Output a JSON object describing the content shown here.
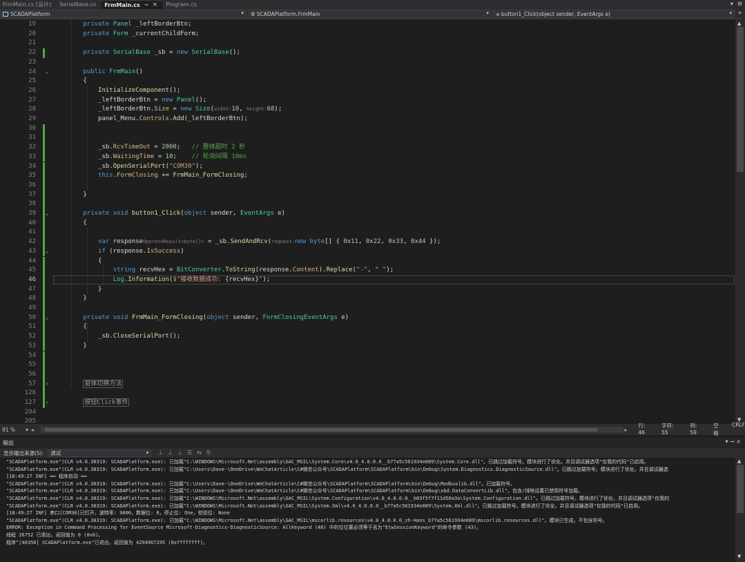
{
  "tabs": [
    {
      "label": "FrmMain.cs [设计]",
      "active": false
    },
    {
      "label": "SerialBase.cs",
      "active": false
    },
    {
      "label": "FrmMain.cs",
      "active": true
    },
    {
      "label": "Program.cs",
      "active": false
    }
  ],
  "nav": {
    "project": "SCADAPlatform",
    "class": "SCADAPlatform.FrmMain",
    "member": "button1_Click(object sender, EventArgs e)"
  },
  "code_lines": [
    {
      "n": "19",
      "tokens": [
        [
          "        ",
          ""
        ],
        [
          "private",
          "kw"
        ],
        [
          " ",
          ""
        ],
        [
          "Panel",
          "ty"
        ],
        [
          " _leftBorderBtn;",
          "id"
        ]
      ]
    },
    {
      "n": "20",
      "tokens": [
        [
          "        ",
          ""
        ],
        [
          "private",
          "kw"
        ],
        [
          " ",
          ""
        ],
        [
          "Form",
          "ty"
        ],
        [
          " _currentChildForm;",
          "id"
        ]
      ]
    },
    {
      "n": "21",
      "tokens": []
    },
    {
      "n": "22",
      "tokens": [
        [
          "        ",
          ""
        ],
        [
          "private",
          "kw"
        ],
        [
          " ",
          ""
        ],
        [
          "SerialBase",
          "ty"
        ],
        [
          " _sb = ",
          "id"
        ],
        [
          "new",
          "kw"
        ],
        [
          " ",
          ""
        ],
        [
          "SerialBase",
          "ty"
        ],
        [
          "();",
          "id"
        ]
      ]
    },
    {
      "n": "23",
      "tokens": []
    },
    {
      "n": "24",
      "tokens": [
        [
          "        ",
          ""
        ],
        [
          "public",
          "kw"
        ],
        [
          " ",
          ""
        ],
        [
          "FrmMain",
          "ty"
        ],
        [
          "()",
          "id"
        ]
      ]
    },
    {
      "n": "25",
      "tokens": [
        [
          "        {",
          "id"
        ]
      ]
    },
    {
      "n": "26",
      "tokens": [
        [
          "            ",
          ""
        ],
        [
          "InitializeComponent",
          "mt"
        ],
        [
          "();",
          "id"
        ]
      ]
    },
    {
      "n": "27",
      "tokens": [
        [
          "            _leftBorderBtn = ",
          "id"
        ],
        [
          "new",
          "kw"
        ],
        [
          " ",
          ""
        ],
        [
          "Panel",
          "ty"
        ],
        [
          "();",
          "id"
        ]
      ]
    },
    {
      "n": "28",
      "tokens": [
        [
          "            _leftBorderBtn.",
          "id"
        ],
        [
          "Size",
          "pr"
        ],
        [
          " = ",
          "id"
        ],
        [
          "new",
          "kw"
        ],
        [
          " ",
          ""
        ],
        [
          "Size",
          "ty"
        ],
        [
          "(",
          "id"
        ],
        [
          "width:",
          "hint"
        ],
        [
          "10",
          "nm"
        ],
        [
          ", ",
          "id"
        ],
        [
          "height:",
          "hint"
        ],
        [
          "68",
          "nm"
        ],
        [
          ");",
          "id"
        ]
      ]
    },
    {
      "n": "29",
      "tokens": [
        [
          "            panel_Menu.",
          "id"
        ],
        [
          "Controls",
          "pr"
        ],
        [
          ".",
          "id"
        ],
        [
          "Add",
          "mt"
        ],
        [
          "(_leftBorderBtn);",
          "id"
        ]
      ]
    },
    {
      "n": "30",
      "tokens": []
    },
    {
      "n": "31",
      "tokens": []
    },
    {
      "n": "32",
      "tokens": [
        [
          "            _sb.",
          "id"
        ],
        [
          "RcvTimeOut",
          "pr"
        ],
        [
          " = ",
          "id"
        ],
        [
          "2000",
          "nm"
        ],
        [
          ";   ",
          "id"
        ],
        [
          "// 整体超时 2 秒",
          "cm"
        ]
      ]
    },
    {
      "n": "33",
      "tokens": [
        [
          "            _sb.",
          "id"
        ],
        [
          "WaitingTime",
          "pr"
        ],
        [
          " = ",
          "id"
        ],
        [
          "10",
          "nm"
        ],
        [
          ";    ",
          "id"
        ],
        [
          "// 轮询间隔 10ms",
          "cm"
        ]
      ]
    },
    {
      "n": "34",
      "tokens": [
        [
          "            _sb.",
          "id"
        ],
        [
          "OpenSerialPort",
          "mt"
        ],
        [
          "(",
          "id"
        ],
        [
          "\"COM30\"",
          "st"
        ],
        [
          ");",
          "id"
        ]
      ]
    },
    {
      "n": "35",
      "tokens": [
        [
          "            ",
          ""
        ],
        [
          "this",
          "kw"
        ],
        [
          ".",
          "id"
        ],
        [
          "FormClosing",
          "pr"
        ],
        [
          " += ",
          "id"
        ],
        [
          "FrmMain_FormClosing",
          "mt"
        ],
        [
          ";",
          "id"
        ]
      ]
    },
    {
      "n": "36",
      "tokens": []
    },
    {
      "n": "37",
      "tokens": [
        [
          "        }",
          "id"
        ]
      ]
    },
    {
      "n": "38",
      "tokens": []
    },
    {
      "n": "39",
      "tokens": [
        [
          "        ",
          ""
        ],
        [
          "private",
          "kw"
        ],
        [
          " ",
          ""
        ],
        [
          "void",
          "kw"
        ],
        [
          " ",
          ""
        ],
        [
          "button1_Click",
          "mt"
        ],
        [
          "(",
          "id"
        ],
        [
          "object",
          "kw"
        ],
        [
          " sender, ",
          "id"
        ],
        [
          "EventArgs",
          "ty"
        ],
        [
          " e)",
          "id"
        ]
      ]
    },
    {
      "n": "40",
      "tokens": [
        [
          "        {",
          "id"
        ]
      ]
    },
    {
      "n": "41",
      "tokens": []
    },
    {
      "n": "42",
      "tokens": [
        [
          "            ",
          ""
        ],
        [
          "var",
          "kw"
        ],
        [
          " response",
          "id"
        ],
        [
          "OperateResult<byte[]>",
          "hint"
        ],
        [
          " = _sb.",
          "id"
        ],
        [
          "SendAndRcv",
          "mt"
        ],
        [
          "(",
          "id"
        ],
        [
          "request:",
          "hint"
        ],
        [
          "new",
          "kw"
        ],
        [
          " ",
          ""
        ],
        [
          "byte",
          "kw"
        ],
        [
          "[] { ",
          "id"
        ],
        [
          "0x11",
          "nm"
        ],
        [
          ", ",
          "id"
        ],
        [
          "0x22",
          "nm"
        ],
        [
          ", ",
          "id"
        ],
        [
          "0x33",
          "nm"
        ],
        [
          ", ",
          "id"
        ],
        [
          "0x44",
          "nm"
        ],
        [
          " });",
          "id"
        ]
      ]
    },
    {
      "n": "43",
      "tokens": [
        [
          "            ",
          ""
        ],
        [
          "if",
          "kw"
        ],
        [
          " (response.",
          "id"
        ],
        [
          "IsSuccess",
          "pr"
        ],
        [
          ")",
          "id"
        ]
      ]
    },
    {
      "n": "44",
      "tokens": [
        [
          "            {",
          "id"
        ]
      ]
    },
    {
      "n": "45",
      "tokens": [
        [
          "                ",
          ""
        ],
        [
          "string",
          "kw"
        ],
        [
          " recvHex = ",
          "id"
        ],
        [
          "BitConverter",
          "ty"
        ],
        [
          ".",
          "id"
        ],
        [
          "ToString",
          "mt"
        ],
        [
          "(response.",
          "id"
        ],
        [
          "Content",
          "pr"
        ],
        [
          ").",
          "id"
        ],
        [
          "Replace",
          "mt"
        ],
        [
          "(",
          "id"
        ],
        [
          "\"-\"",
          "st"
        ],
        [
          ", ",
          "id"
        ],
        [
          "\" \"",
          "st"
        ],
        [
          ");",
          "id"
        ]
      ]
    },
    {
      "n": "46",
      "tokens": [
        [
          "                ",
          ""
        ],
        [
          "Log",
          "ty"
        ],
        [
          ".",
          "id"
        ],
        [
          "Information",
          "mt"
        ],
        [
          "(",
          "id"
        ],
        [
          "$\"接收数据成功: ",
          "st"
        ],
        [
          "{recvHex}",
          "id"
        ],
        [
          "\"",
          "st"
        ],
        [
          ");",
          "id"
        ]
      ]
    },
    {
      "n": "47",
      "tokens": [
        [
          "            }",
          "id"
        ]
      ]
    },
    {
      "n": "48",
      "tokens": [
        [
          "        }",
          "id"
        ]
      ]
    },
    {
      "n": "49",
      "tokens": []
    },
    {
      "n": "50",
      "tokens": [
        [
          "        ",
          ""
        ],
        [
          "private",
          "kw"
        ],
        [
          " ",
          ""
        ],
        [
          "void",
          "kw"
        ],
        [
          " ",
          ""
        ],
        [
          "FrmMain_FormClosing",
          "mt"
        ],
        [
          "(",
          "id"
        ],
        [
          "object",
          "kw"
        ],
        [
          " sender, ",
          "id"
        ],
        [
          "FormClosingEventArgs",
          "ty"
        ],
        [
          " e)",
          "id"
        ]
      ]
    },
    {
      "n": "51",
      "tokens": [
        [
          "        {",
          "id"
        ]
      ]
    },
    {
      "n": "52",
      "tokens": [
        [
          "            _sb.",
          "id"
        ],
        [
          "CloseSerialPort",
          "mt"
        ],
        [
          "();",
          "id"
        ]
      ]
    },
    {
      "n": "53",
      "tokens": [
        [
          "        }",
          "id"
        ]
      ]
    },
    {
      "n": "54",
      "tokens": []
    },
    {
      "n": "55",
      "tokens": []
    },
    {
      "n": "56",
      "tokens": []
    },
    {
      "n": "57",
      "tokens": [
        [
          "        ",
          ""
        ],
        [
          "窗体切换方法",
          "collapsed"
        ]
      ]
    },
    {
      "n": "126",
      "tokens": []
    },
    {
      "n": "127",
      "tokens": [
        [
          "        ",
          ""
        ],
        [
          "按钮Click事件",
          "collapsed"
        ]
      ]
    },
    {
      "n": "204",
      "tokens": []
    },
    {
      "n": "205",
      "tokens": []
    }
  ],
  "current_line": "46",
  "status": {
    "zoom": "91 %",
    "line": "行: 46",
    "char": "字符: 55",
    "col": "列: 59",
    "indent": "空格",
    "eol": "CRLF"
  },
  "output": {
    "title": "输出",
    "source_label": "显示输出来源(S):",
    "source_value": "调试",
    "lines": [
      "\"SCADAPlatform.exe\"(CLR v4.0.30319: SCADAPlatform.exe): 已加载\"C:\\WINDOWS\\Microsoft.Net\\assembly\\GAC_MSIL\\System.Core\\v4.0_4.0.0.0__b77a5c561934e089\\System.Core.dll\"。已跳过加载符号。模块进行了优化，并且调试器选项\"仅我的代码\"已启用。",
      "\"SCADAPlatform.exe\"(CLR v4.0.30319: SCADAPlatform.exe): 已加载\"C:\\Users\\Dave-\\OneDrive\\WeChatArticle\\C#微信公众号\\SCADAPlatform\\SCADAPlatform\\bin\\Debug\\System.Diagnostics.DiagnosticSource.dll\"。已跳过加载符号。模块进行了优化，并且调试器选",
      "[18:49:27 INF] ══ 程序启动 ══",
      "\"SCADAPlatform.exe\"(CLR v4.0.30319: SCADAPlatform.exe): 已加载\"C:\\Users\\Dave-\\OneDrive\\WeChatArticle\\C#微信公众号\\SCADAPlatform\\SCADAPlatform\\bin\\Debug\\Modbuslib.dll\"。已加载符号。",
      "\"SCADAPlatform.exe\"(CLR v4.0.30319: SCADAPlatform.exe): 已加载\"C:\\Users\\Dave-\\OneDrive\\WeChatArticle\\C#微信公众号\\SCADAPlatform\\SCADAPlatform\\bin\\Debug\\xbd.DataConvertLib.dll\"。包含/排除设置已禁用符号加载。",
      "\"SCADAPlatform.exe\"(CLR v4.0.30319: SCADAPlatform.exe): 已加载\"C:\\WINDOWS\\Microsoft.Net\\assembly\\GAC_MSIL\\System.Configuration\\v4.0_4.0.0.0__b03f5f7f11d50a3a\\System.Configuration.dll\"。已跳过加载符号。模块进行了优化，并且调试器选项\"仅我的",
      "\"SCADAPlatform.exe\"(CLR v4.0.30319: SCADAPlatform.exe): 已加载\"C:\\WINDOWS\\Microsoft.Net\\assembly\\GAC_MSIL\\System.Xml\\v4.0_4.0.0.0__b77a5c561934e089\\System.Xml.dll\"。已跳过加载符号。模块进行了优化，并且调试器选项\"仅我的代码\"已启用。",
      "[18:49:27 INF] 串口[COM30]已打开，波特率: 9600，数据位: 8，停止位: One，校验位: None",
      "\"SCADAPlatform.exe\"(CLR v4.0.30319: SCADAPlatform.exe): 已加载\"C:\\WINDOWS\\Microsoft.Net\\assembly\\GAC_MSIL\\mscorlib.resources\\v4.0_4.0.0.0_zh-Hans_b77a5c561934e089\\mscorlib.resources.dll\"。模块已生成，不包含符号。",
      "ERROR: Exception in Command Processing for EventSource Microsoft-Diagnostics-DiagnosticSource: AllKeyword (48) 中的位位置必须等于名为\"EtwSessionKeyword\"的命令参数 (43)。",
      "线程 26752 已退出，返回值为 0 (0x0)。",
      "程序\"[40356] SCADAPlatform.exe\"已退出，返回值为 4294967295 (0xffffffff)。"
    ]
  }
}
